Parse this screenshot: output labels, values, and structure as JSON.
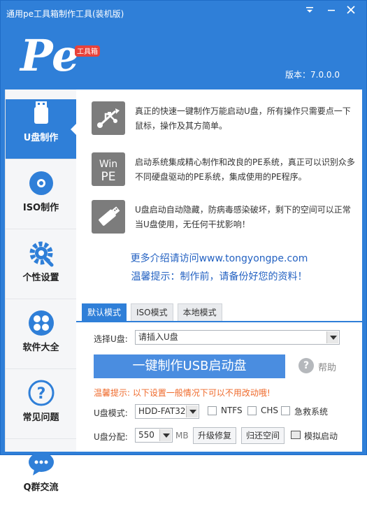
{
  "window": {
    "title": "通用pe工具箱制作工具(装机版)",
    "version": "版本：7.0.0.0",
    "logo_badge": "工具箱"
  },
  "sidebar": {
    "items": [
      {
        "label": "U盘制作",
        "icon": "usb-drive-icon",
        "active": true
      },
      {
        "label": "ISO制作",
        "icon": "disc-icon",
        "active": false
      },
      {
        "label": "个性设置",
        "icon": "gear-wrench-icon",
        "active": false
      },
      {
        "label": "软件大全",
        "icon": "apps-grid-icon",
        "active": false
      },
      {
        "label": "常见问题",
        "icon": "question-icon",
        "active": false
      },
      {
        "label": "Q群交流",
        "icon": "chat-bubble-icon",
        "active": false
      }
    ]
  },
  "features": [
    {
      "icon": "usb-symbol-icon",
      "text": "真正的快速一键制作万能启动U盘，所有操作只需要点一下鼠标，操作及其方简单。"
    },
    {
      "icon": "win-pe-icon",
      "icon_text_1": "Win",
      "icon_text_2": "PE",
      "text": "启动系统集成精心制作和改良的PE系统，真正可以识别众多不同硬盘驱动的PE系统，集成使用的PE程序。"
    },
    {
      "icon": "usb-stick-icon",
      "text": "U盘启动自动隐藏，防病毒感染破坏，剩下的空间可以正常当U盘使用，无任何干扰影响！"
    }
  ],
  "links": {
    "more": "更多介绍请访问www.tongyongpe.com",
    "tip": "温馨提示：制作前，请备份好您的资料！"
  },
  "tabs": [
    {
      "label": "默认模式",
      "active": true
    },
    {
      "label": "ISO模式",
      "active": false
    },
    {
      "label": "本地模式",
      "active": false
    }
  ],
  "form": {
    "select_label": "选择U盘:",
    "select_value": "请插入U盘",
    "make_button": "一键制作USB启动盘",
    "help_label": "帮助",
    "warning": "温馨提示: 以下设置一般情况下可以不用改动哦!",
    "mode_label": "U盘模式:",
    "mode_value": "HDD-FAT32",
    "ntfs_label": "NTFS",
    "chs_label": "CHS",
    "rescue_label": "急救系统",
    "partition_label": "U盘分配:",
    "partition_value": "550",
    "partition_unit": "MB",
    "upgrade_button": "升级修复",
    "restore_button": "归还空间",
    "simulate_label": "模拟启动"
  },
  "colors": {
    "accent": "#2f7fd8",
    "link": "#2462c2",
    "warning": "#ef6a2b"
  }
}
